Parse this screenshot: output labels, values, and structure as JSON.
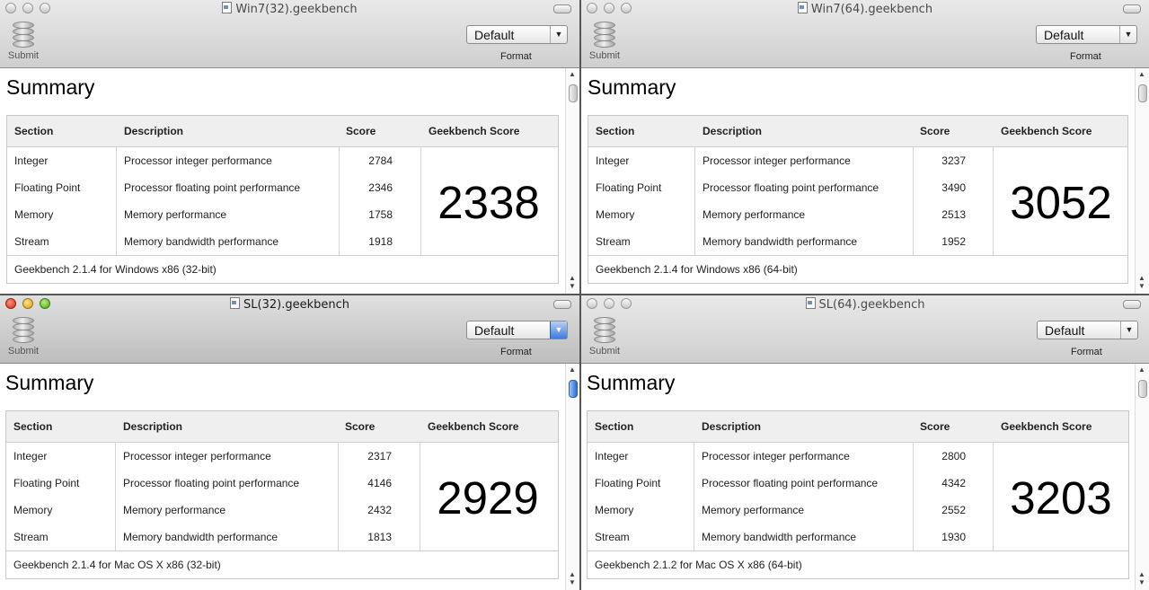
{
  "common": {
    "submit_label": "Submit",
    "format_label": "Format",
    "summary_heading": "Summary",
    "headers": {
      "section": "Section",
      "description": "Description",
      "score": "Score",
      "geekbench_score": "Geekbench Score"
    },
    "rows": [
      {
        "section": "Integer",
        "description": "Processor integer performance"
      },
      {
        "section": "Floating Point",
        "description": "Processor floating point performance"
      },
      {
        "section": "Memory",
        "description": "Memory performance"
      },
      {
        "section": "Stream",
        "description": "Memory bandwidth performance"
      }
    ]
  },
  "windows": [
    {
      "title": "Win7(32).geekbench",
      "format_value": "Default",
      "active": false,
      "scores": [
        "2784",
        "2346",
        "1758",
        "1918"
      ],
      "geekbench_score": "2338",
      "footer": "Geekbench 2.1.4 for Windows x86 (32-bit)"
    },
    {
      "title": "Win7(64).geekbench",
      "format_value": "Default",
      "active": false,
      "scores": [
        "3237",
        "3490",
        "2513",
        "1952"
      ],
      "geekbench_score": "3052",
      "footer": "Geekbench 2.1.4 for Windows x86 (64-bit)"
    },
    {
      "title": "SL(32).geekbench",
      "format_value": "Default",
      "active": true,
      "scores": [
        "2317",
        "4146",
        "2432",
        "1813"
      ],
      "geekbench_score": "2929",
      "footer": "Geekbench 2.1.4 for Mac OS X x86 (32-bit)"
    },
    {
      "title": "SL(64).geekbench",
      "format_value": "Default",
      "active": false,
      "scores": [
        "2800",
        "4342",
        "2552",
        "1930"
      ],
      "geekbench_score": "3203",
      "footer": "Geekbench 2.1.2 for Mac OS X x86 (64-bit)"
    }
  ]
}
